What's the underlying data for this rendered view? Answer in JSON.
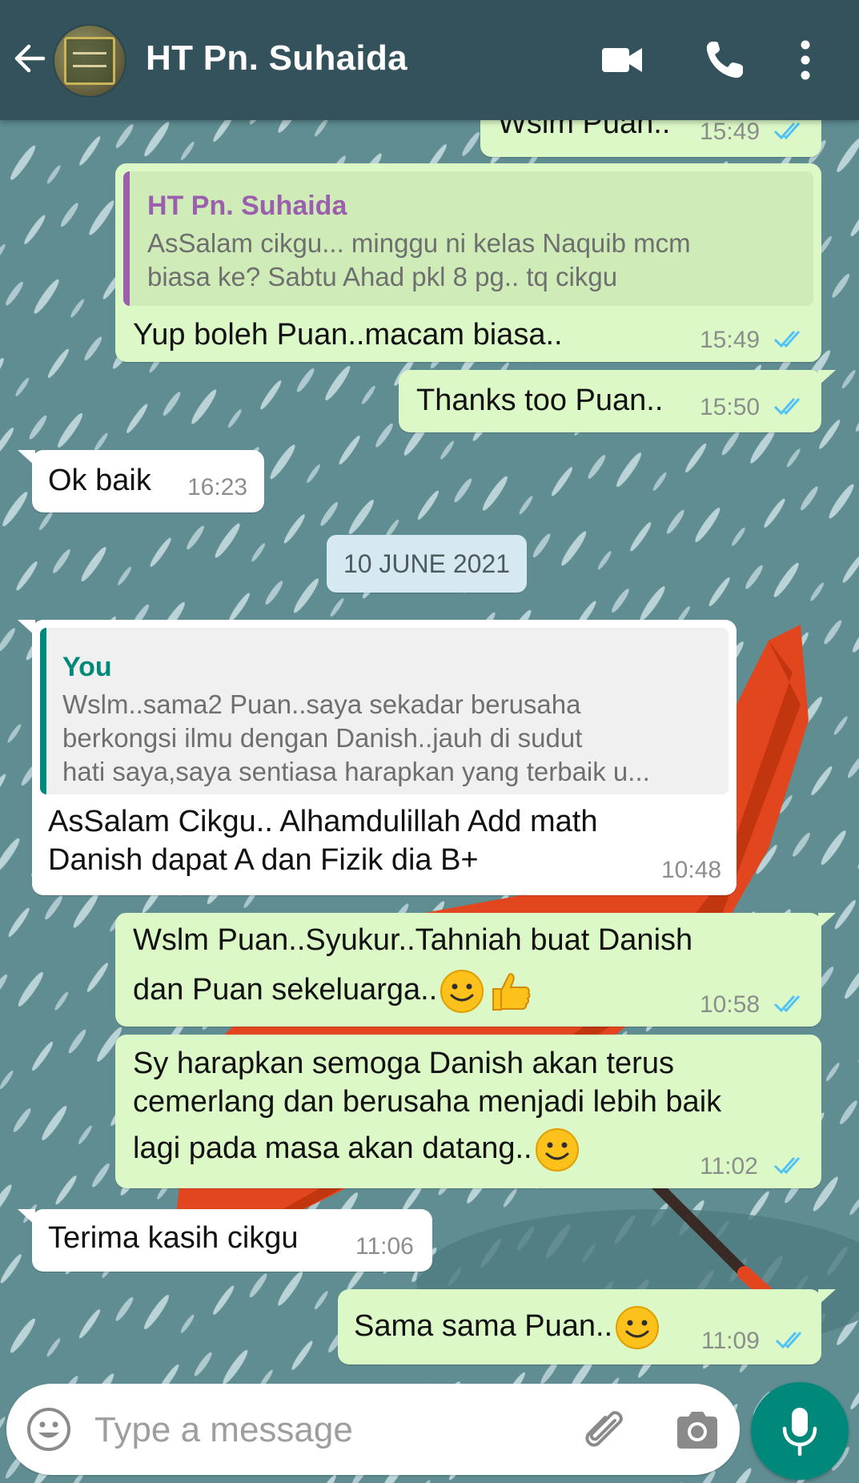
{
  "header": {
    "contact_name": "HT Pn. Suhaida",
    "icons": [
      "back-arrow-icon",
      "video-call-icon",
      "voice-call-icon",
      "more-options-icon"
    ]
  },
  "colors": {
    "header_bg": "#34525b",
    "outgoing_bubble": "#dcf8c6",
    "incoming_bubble": "#ffffff",
    "read_ticks": "#4fc3f7",
    "mic_button": "#00897b",
    "quote_name_contact": "#9c5fae",
    "quote_name_you": "#00897b"
  },
  "messages": [
    {
      "direction": "out",
      "text": "Wslm Puan..",
      "time": "15:49",
      "status": "read"
    },
    {
      "direction": "out",
      "quote": {
        "name": "HT Pn. Suhaida",
        "lines": [
          "AsSalam cikgu... minggu ni kelas Naquib mcm",
          "biasa ke? Sabtu Ahad pkl 8 pg.. tq cikgu"
        ]
      },
      "text": "Yup boleh Puan..macam biasa..",
      "time": "15:49",
      "status": "read"
    },
    {
      "direction": "out",
      "text": "Thanks too Puan..",
      "time": "15:50",
      "status": "read"
    },
    {
      "direction": "in",
      "text": "Ok baik",
      "time": "16:23"
    },
    {
      "direction": "in",
      "quote": {
        "name": "You",
        "lines": [
          "Wslm..sama2 Puan..saya sekadar berusaha",
          "berkongsi ilmu dengan Danish..jauh di sudut",
          "hati saya,saya sentiasa harapkan yang terbaik u..."
        ]
      },
      "lines": [
        "AsSalam Cikgu.. Alhamdulillah Add math",
        "Danish dapat A dan Fizik dia B+"
      ],
      "time": "10:48"
    },
    {
      "direction": "out",
      "lines": [
        "Wslm Puan..Syukur..Tahniah buat Danish",
        "dan Puan sekeluarga.."
      ],
      "emojis": [
        "smiling-face-emoji",
        "thumbs-up-emoji"
      ],
      "time": "10:58",
      "status": "read"
    },
    {
      "direction": "out",
      "lines": [
        "Sy harapkan semoga Danish akan terus",
        "cemerlang dan berusaha menjadi  lebih baik",
        "lagi pada masa akan datang.."
      ],
      "emojis": [
        "smiling-face-emoji"
      ],
      "time": "11:02",
      "status": "read"
    },
    {
      "direction": "in",
      "text": "Terima kasih cikgu",
      "time": "11:06"
    },
    {
      "direction": "out",
      "text": "Sama sama Puan..",
      "emojis": [
        "smiling-face-emoji"
      ],
      "time": "11:09",
      "status": "read"
    }
  ],
  "date_separator": "10 JUNE 2021",
  "composer": {
    "placeholder": "Type a message",
    "icons": [
      "emoji-icon",
      "attach-icon",
      "camera-icon",
      "mic-icon"
    ]
  }
}
